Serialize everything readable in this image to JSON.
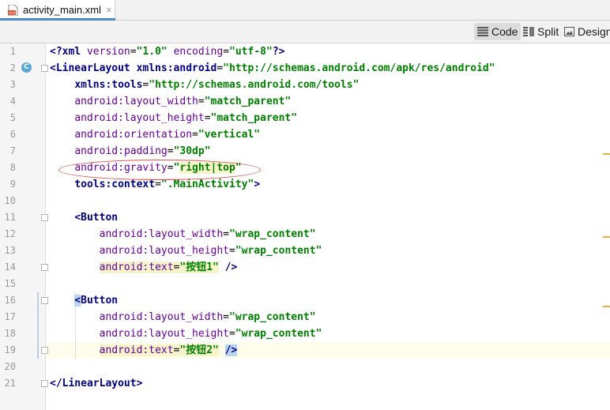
{
  "tab": {
    "label": "activity_main.xml",
    "close": "×"
  },
  "toolbar": {
    "code_label": "Code",
    "split_label": "Split",
    "design_label": "Design"
  },
  "gutter": {
    "line_numbers": [
      "1",
      "2",
      "3",
      "4",
      "5",
      "6",
      "7",
      "8",
      "9",
      "10",
      "11",
      "12",
      "13",
      "14",
      "15",
      "16",
      "17",
      "18",
      "19",
      "20",
      "21"
    ],
    "class_badge": "C"
  },
  "code": {
    "l1": {
      "open": "<?xml ",
      "a1": "version",
      "eq1": "=",
      "v1": "\"1.0\"",
      "sp": " ",
      "a2": "encoding",
      "eq2": "=",
      "v2": "\"utf-8\"",
      "close": "?>"
    },
    "l2": {
      "tag": "<LinearLayout",
      "sp": " ",
      "ns": "xmlns:",
      "attr": "android",
      "eq": "=",
      "val": "\"http://schemas.android.com/apk/res/android\""
    },
    "l3": {
      "indent": "    ",
      "ns": "xmlns:",
      "attr": "tools",
      "eq": "=",
      "val": "\"http://schemas.android.com/tools\""
    },
    "l4": {
      "indent": "    ",
      "ns": "android:",
      "attr": "layout_width",
      "eq": "=",
      "val": "\"match_parent\""
    },
    "l5": {
      "indent": "    ",
      "ns": "android:",
      "attr": "layout_height",
      "eq": "=",
      "val": "\"match_parent\""
    },
    "l6": {
      "indent": "    ",
      "ns": "android:",
      "attr": "orientation",
      "eq": "=",
      "val": "\"vertical\""
    },
    "l7": {
      "indent": "    ",
      "ns": "android:",
      "attr": "padding",
      "eq": "=",
      "val": "\"30dp\""
    },
    "l8": {
      "indent": "    ",
      "ns": "android:",
      "attr": "gravity",
      "eq": "=",
      "q1": "\"",
      "val": "right|top",
      "q2": "\""
    },
    "l9": {
      "indent": "    ",
      "ns": "tools:",
      "attr": "context",
      "eq": "=",
      "val": "\".MainActivity\"",
      "close": ">"
    },
    "l11": {
      "indent": "    ",
      "tag": "<Button"
    },
    "l12": {
      "indent": "        ",
      "ns": "android:",
      "attr": "layout_width",
      "eq": "=",
      "val": "\"wrap_content\""
    },
    "l13": {
      "indent": "        ",
      "ns": "android:",
      "attr": "layout_height",
      "eq": "=",
      "val": "\"wrap_content\""
    },
    "l14": {
      "indent": "        ",
      "ns": "android:",
      "attr": "text",
      "eq": "=",
      "val": "\"按钮1\"",
      "close": " />"
    },
    "l16": {
      "indent": "    ",
      "lt": "<",
      "tag": "Button"
    },
    "l17": {
      "indent": "        ",
      "ns": "android:",
      "attr": "layout_width",
      "eq": "=",
      "val": "\"wrap_content\""
    },
    "l18": {
      "indent": "        ",
      "ns": "android:",
      "attr": "layout_height",
      "eq": "=",
      "val": "\"wrap_content\""
    },
    "l19": {
      "indent": "        ",
      "ns": "android:",
      "attr": "text",
      "eq": "=",
      "val": "\"按钮2\"",
      "sp": " ",
      "close": "/>"
    },
    "l21": {
      "tag": "</LinearLayout>"
    }
  },
  "colors": {
    "tag": "#000080",
    "attribute": "#660099",
    "value": "#008000",
    "annotation_ellipse": "#e05050"
  }
}
